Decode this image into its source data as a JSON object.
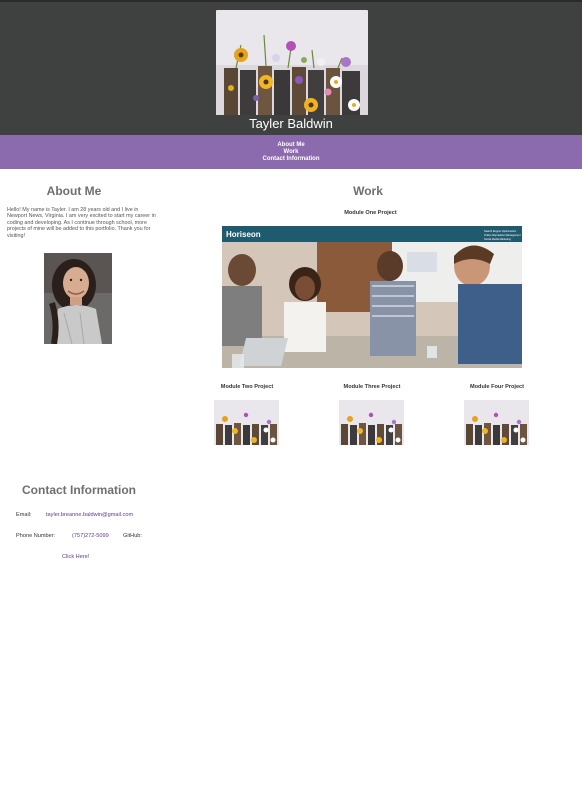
{
  "header": {
    "title": "Tayler Baldwin"
  },
  "nav": {
    "items": [
      "About Me",
      "Work",
      "Contact Information"
    ]
  },
  "about": {
    "heading": "About Me",
    "text": "Hello! My name is Tayler. I am 28 years old and I live in Newport News, Virginia. I am very excited to start my career in coding and developing. As I continue through school, more projects of mine will be added to this portfolio. Thank you for visiting!"
  },
  "work": {
    "heading": "Work",
    "main_project_label": "Module One Project",
    "main_project_brand": "Horiseon",
    "main_project_nav": [
      "Search Engine Optimization",
      "Online Reputation Management",
      "Social Media Marketing"
    ],
    "projects": [
      {
        "label": "Module Two Project"
      },
      {
        "label": "Module Three Project"
      },
      {
        "label": "Module Four Project"
      }
    ]
  },
  "contact": {
    "heading": "Contact Information",
    "email_label": "Email:",
    "email_value": "tayler.breanne.baldwin@gmail.com",
    "phone_label": "Phone Number:",
    "phone_value": "(757)272-5099",
    "github_label": "GitHub:",
    "github_link": "Click Here!"
  },
  "colors": {
    "header_bg": "#3f4040",
    "nav_bg": "#8c6aae",
    "heading": "#6f6f6f",
    "link": "#5b3c8a"
  }
}
